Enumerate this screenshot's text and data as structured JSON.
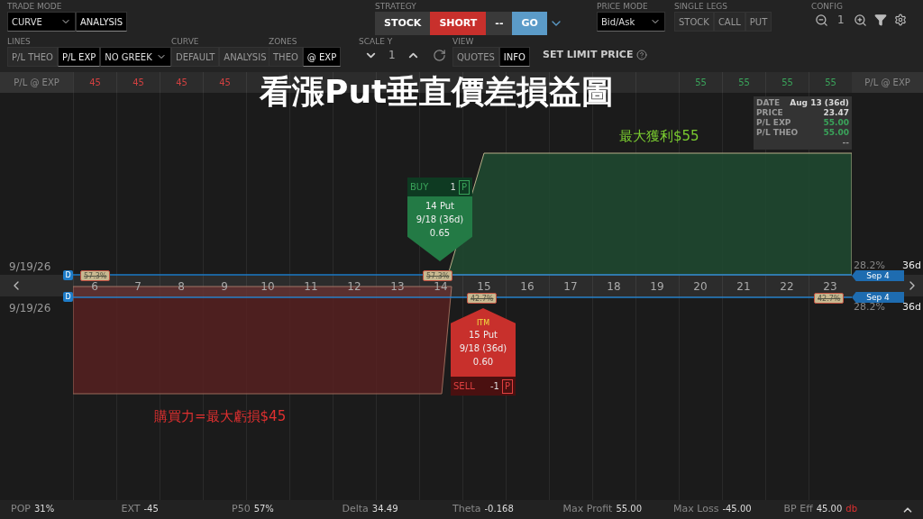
{
  "toolbar_rows": [
    [
      {
        "label": "TRADE MODE",
        "controls": [
          {
            "kind": "dropdown",
            "text": "CURVE"
          },
          {
            "kind": "button",
            "text": "ANALYSIS",
            "selected": true
          }
        ]
      },
      {
        "label": "STRATEGY",
        "controls": [
          {
            "kind": "chip",
            "text": "STOCK",
            "color": "#3a3a3a"
          },
          {
            "kind": "chip",
            "text": "SHORT",
            "color": "#c8302c"
          },
          {
            "kind": "chip",
            "text": "--",
            "color": "#3a3a3a"
          },
          {
            "kind": "chip",
            "text": "GO",
            "color": "#5b9bc8"
          },
          {
            "kind": "chevron"
          }
        ]
      },
      {
        "label": "PRICE MODE",
        "controls": [
          {
            "kind": "dropdown",
            "text": "Bid/Ask"
          }
        ]
      },
      {
        "label": "SINGLE LEGS",
        "controls": [
          {
            "kind": "button",
            "text": "STOCK",
            "selected": false
          },
          {
            "kind": "button",
            "text": "CALL",
            "selected": false
          },
          {
            "kind": "button",
            "text": "PUT",
            "selected": false
          }
        ]
      },
      {
        "label": "CONFIG",
        "controls": [
          {
            "kind": "zoom_out"
          },
          {
            "kind": "value",
            "text": "1"
          },
          {
            "kind": "zoom_in"
          },
          {
            "kind": "filter"
          },
          {
            "kind": "gear"
          }
        ]
      }
    ],
    [
      {
        "label": "LINES",
        "controls": [
          {
            "kind": "button",
            "text": "P/L THEO",
            "selected": false
          },
          {
            "kind": "button",
            "text": "P/L EXP",
            "selected": true
          },
          {
            "kind": "dropdown",
            "text": "NO GREEK"
          }
        ]
      },
      {
        "label": "CURVE",
        "controls": [
          {
            "kind": "button",
            "text": "DEFAULT",
            "selected": false
          },
          {
            "kind": "button",
            "text": "ANALYSIS",
            "selected": false
          }
        ]
      },
      {
        "label": "ZONES",
        "controls": [
          {
            "kind": "button",
            "text": "THEO",
            "selected": false
          },
          {
            "kind": "button",
            "text": "@ EXP",
            "selected": true
          }
        ]
      },
      {
        "label": "SCALE Y",
        "controls": [
          {
            "kind": "down"
          },
          {
            "kind": "value",
            "text": "1"
          },
          {
            "kind": "up"
          },
          {
            "kind": "refresh"
          }
        ]
      },
      {
        "label": "VIEW",
        "controls": [
          {
            "kind": "button",
            "text": "QUOTES",
            "selected": false
          },
          {
            "kind": "button",
            "text": "INFO",
            "selected": true
          }
        ]
      },
      {
        "controls": [
          {
            "kind": "link",
            "text": "SET LIMIT PRICE"
          }
        ]
      }
    ]
  ],
  "chart": {
    "header_left": "P/L @ EXP",
    "header_right": "P/L @ EXP",
    "columns": [
      {
        "strike": "6",
        "pl": "45"
      },
      {
        "strike": "7",
        "pl": "45"
      },
      {
        "strike": "8",
        "pl": "45"
      },
      {
        "strike": "9",
        "pl": "45"
      },
      {
        "strike": "10"
      },
      {
        "strike": "11"
      },
      {
        "strike": "12"
      },
      {
        "strike": "13"
      },
      {
        "strike": "14"
      },
      {
        "strike": "15"
      },
      {
        "strike": "16"
      },
      {
        "strike": "17"
      },
      {
        "strike": "18"
      },
      {
        "strike": "19"
      },
      {
        "strike": "20",
        "pl": "55"
      },
      {
        "strike": "21",
        "pl": "55"
      },
      {
        "strike": "22",
        "pl": "55"
      },
      {
        "strike": "23",
        "pl": "55"
      }
    ],
    "rows": [
      {
        "date": "9/19/26",
        "marker": "D",
        "iv": "28.2%",
        "days": "36d",
        "tag": "Sep 4",
        "prob": [
          "57.3%",
          "57.3%"
        ]
      },
      {
        "date": "9/19/26",
        "marker": "D",
        "iv": "28.2%",
        "days": "36d",
        "tag": "Sep 4",
        "prob": [
          "42.7%",
          "42.7%"
        ]
      }
    ],
    "info": [
      {
        "label": "DATE",
        "value": "Aug 13 (36d)",
        "color": "#d8d8d8"
      },
      {
        "label": "PRICE",
        "value": "23.47",
        "color": "#d8d8d8"
      },
      {
        "label": "P/L EXP",
        "value": "55.00",
        "color": "#3aa35a"
      },
      {
        "label": "P/L THEO",
        "value": "55.00",
        "color": "#3aa35a"
      },
      {
        "value": "--",
        "color": "#9a9a9a"
      }
    ],
    "legs": [
      {
        "kind": "buy",
        "side": "BUY",
        "qty": "1",
        "type": "P",
        "contract": "14 Put",
        "expiry": "9/18 (36d)",
        "price": "0.65"
      },
      {
        "kind": "sell",
        "badge": "ITM",
        "side": "SELL",
        "qty": "-1",
        "type": "P",
        "contract": "15 Put",
        "expiry": "9/18 (36d)",
        "price": "0.60"
      }
    ],
    "title": "看漲Put垂直價差損益圖",
    "max_profit": "最大獲利$55",
    "max_loss": "購買力=最大虧損$45"
  },
  "stats": [
    {
      "label": "POP",
      "value": "31%"
    },
    {
      "label": "EXT",
      "value": "-45"
    },
    {
      "label": "P50",
      "value": "57%"
    },
    {
      "label": "Delta",
      "value": "34.49"
    },
    {
      "label": "Theta",
      "value": "-0.168"
    },
    {
      "label": "Max Profit",
      "value": "55.00"
    },
    {
      "label": "Max Loss",
      "value": "-45.00"
    },
    {
      "label": "BP Eff",
      "value": "45.00",
      "unit": "db"
    }
  ]
}
